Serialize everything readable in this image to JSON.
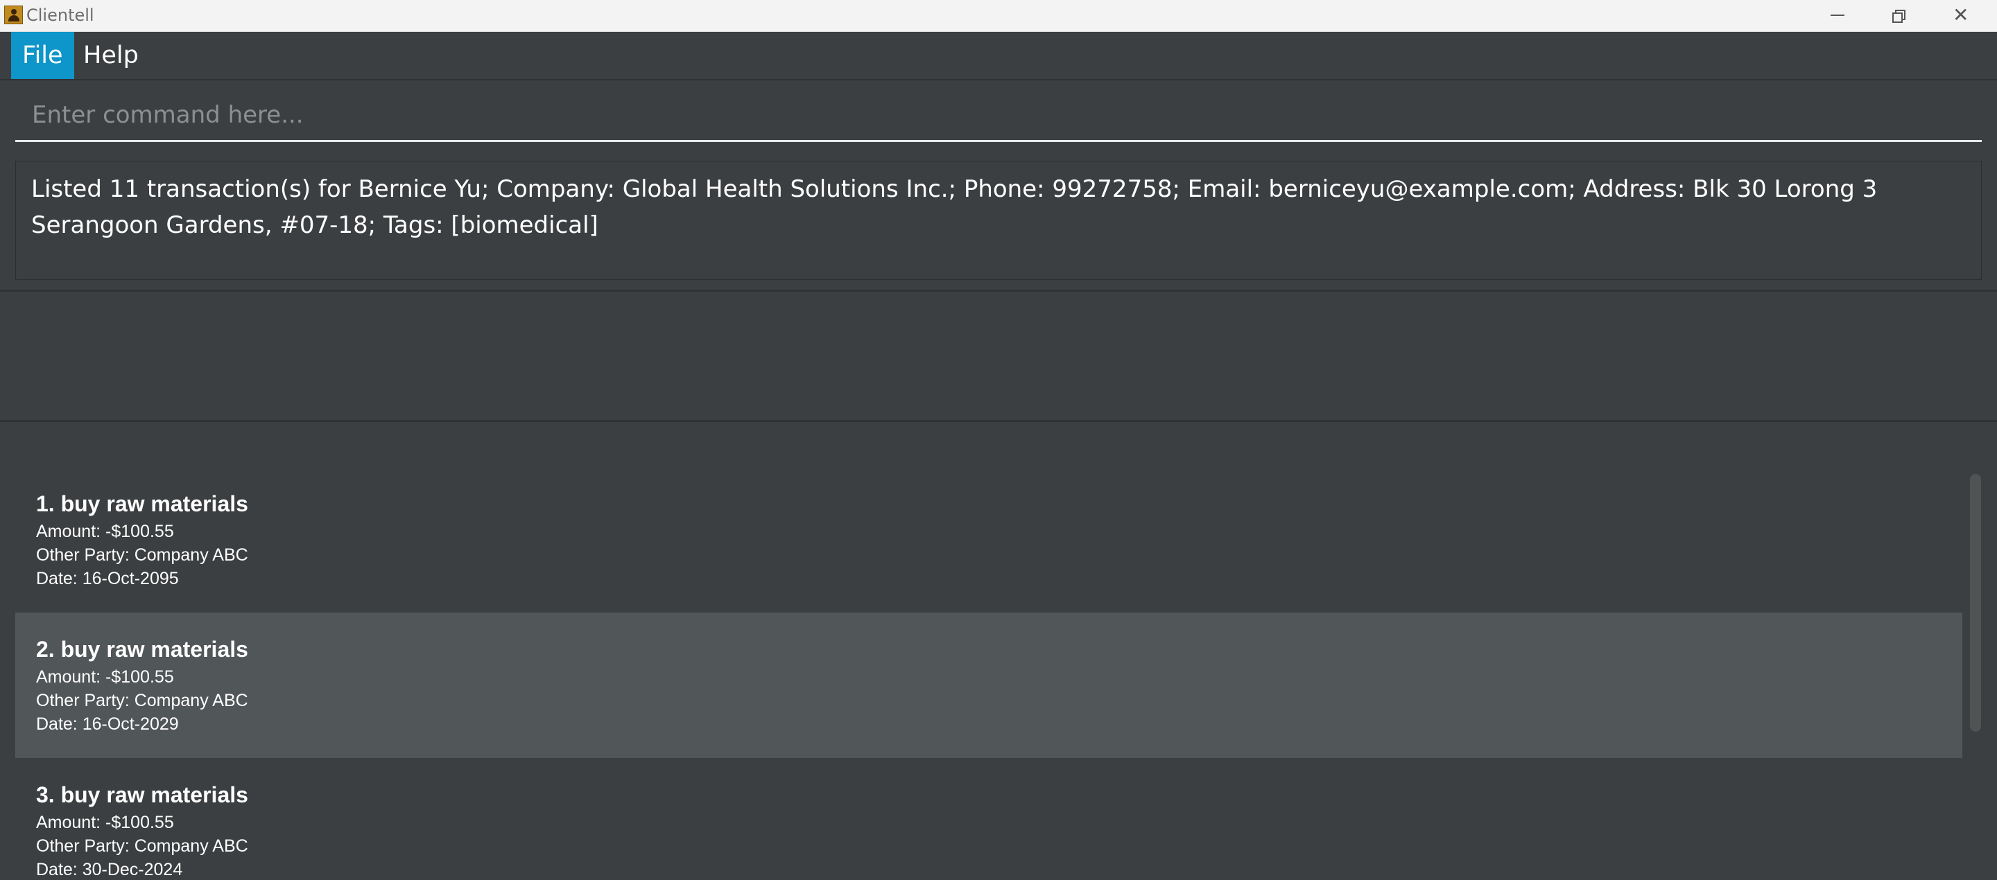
{
  "window": {
    "title": "Clientell"
  },
  "menu": {
    "items": [
      {
        "label": "File"
      },
      {
        "label": "Help"
      }
    ]
  },
  "command": {
    "placeholder": "Enter command here...",
    "value": ""
  },
  "result": {
    "text": "Listed 11 transaction(s) for Bernice Yu; Company: Global Health Solutions Inc.; Phone: 99272758; Email: berniceyu@example.com; Address: Blk 30 Lorong 3 Serangoon Gardens, #07-18; Tags: [biomedical]"
  },
  "transactions": [
    {
      "title": "1. buy raw materials",
      "amount": "Amount: -$100.55",
      "other_party": "Other Party: Company ABC",
      "date": "Date: 16-Oct-2095"
    },
    {
      "title": "2. buy raw materials",
      "amount": "Amount: -$100.55",
      "other_party": "Other Party: Company ABC",
      "date": "Date: 16-Oct-2029"
    },
    {
      "title": "3. buy raw materials",
      "amount": "Amount: -$100.55",
      "other_party": "Other Party: Company ABC",
      "date": "Date: 30-Dec-2024"
    }
  ],
  "colors": {
    "background": "#3c3f41",
    "menu_selected": "#0e95c9",
    "row_alt": "#515658"
  },
  "icons": {
    "app": "person-card-icon",
    "minimize": "minimize-icon",
    "maximize": "restore-icon",
    "close": "close-icon"
  }
}
